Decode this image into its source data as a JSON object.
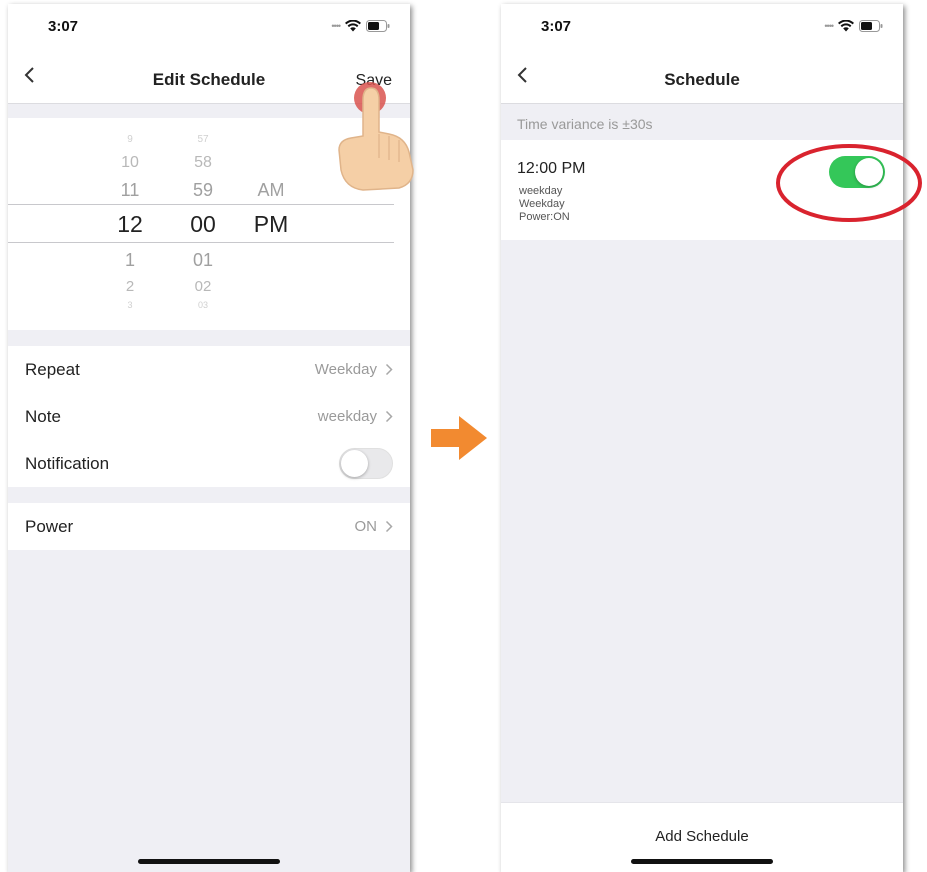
{
  "left": {
    "status": {
      "time": "3:07"
    },
    "nav": {
      "title": "Edit Schedule",
      "save": "Save"
    },
    "picker": {
      "hours": [
        "9",
        "10",
        "11",
        "12",
        "1",
        "2",
        "3"
      ],
      "minutes": [
        "57",
        "58",
        "59",
        "00",
        "01",
        "02",
        "03"
      ],
      "ampm": [
        "AM",
        "PM"
      ]
    },
    "settings": [
      {
        "label": "Repeat",
        "value": "Weekday"
      },
      {
        "label": "Note",
        "value": "weekday"
      },
      {
        "label": "Notification",
        "enabled": false
      }
    ],
    "power": {
      "label": "Power",
      "value": "ON"
    }
  },
  "right": {
    "status": {
      "time": "3:07"
    },
    "nav": {
      "title": "Schedule"
    },
    "variance": "Time variance is  ±30s",
    "schedule": {
      "time": "12:00 PM",
      "note": "weekday",
      "repeat": "Weekday",
      "action": "Power:ON",
      "enabled": true
    },
    "add_label": "Add Schedule"
  },
  "colors": {
    "toggle_on": "#34c759",
    "arrow": "#f28a30",
    "highlight_ring": "#d9232e",
    "background": "#efeff4"
  },
  "icons": [
    "back-chevron-icon",
    "wifi-icon",
    "battery-icon",
    "chevron-right-icon",
    "tap-hand-icon",
    "right-arrow-icon"
  ]
}
